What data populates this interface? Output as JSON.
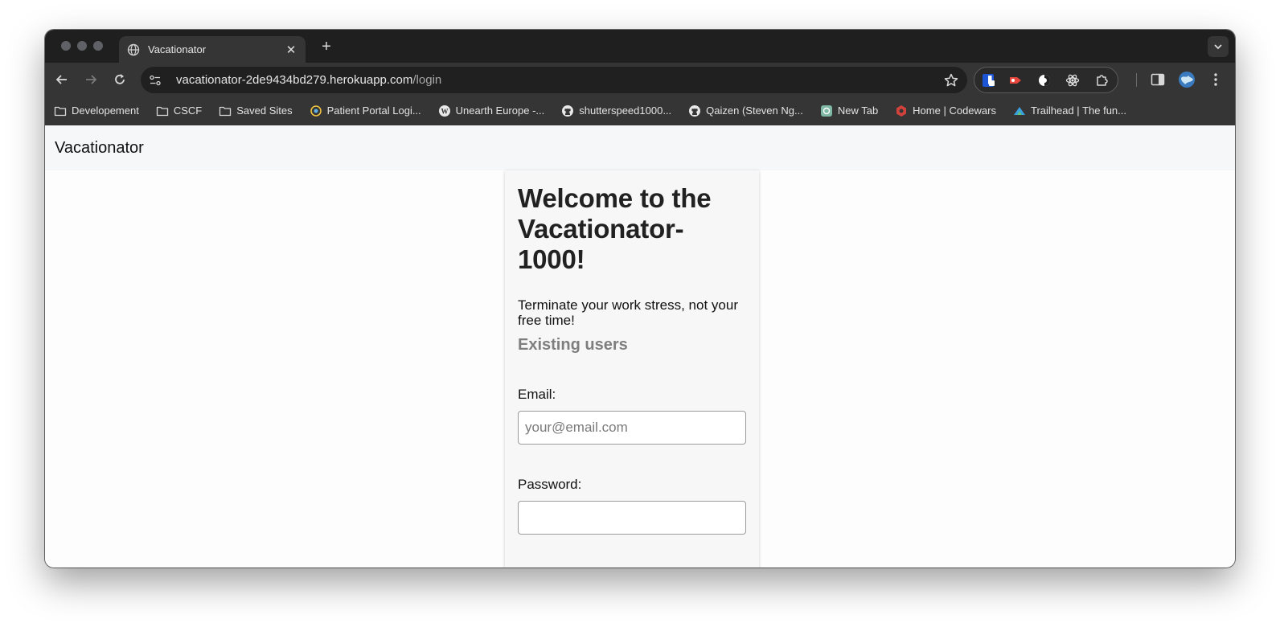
{
  "browser": {
    "tab_title": "Vacationator",
    "url_host": "vacationator-2de9434bd279.herokuapp.com",
    "url_path": "/login",
    "bookmarks": [
      {
        "label": "Developement",
        "icon": "folder-icon"
      },
      {
        "label": "CSCF",
        "icon": "folder-icon"
      },
      {
        "label": "Saved Sites",
        "icon": "folder-icon"
      },
      {
        "label": "Patient Portal Logi...",
        "icon": "portal-icon"
      },
      {
        "label": "Unearth Europe -...",
        "icon": "wordpress-icon"
      },
      {
        "label": "shutterspeed1000...",
        "icon": "github-icon"
      },
      {
        "label": "Qaizen (Steven Ng...",
        "icon": "github-icon"
      },
      {
        "label": "New Tab",
        "icon": "openai-icon"
      },
      {
        "label": "Home | Codewars",
        "icon": "codewars-icon"
      },
      {
        "label": "Trailhead | The fun...",
        "icon": "trailhead-icon"
      }
    ]
  },
  "app": {
    "brand": "Vacationator",
    "heading": "Welcome to the Vacationator-1000!",
    "tagline": "Terminate your work stress, not your free time!",
    "section_title": "Existing users",
    "email_label": "Email:",
    "email_placeholder": "your@email.com",
    "password_label": "Password:",
    "password_value": ""
  },
  "colors": {
    "tabstrip": "#1f1f1f",
    "toolbar": "#353535",
    "omnibox": "#202020",
    "navbar": "#f6f7f8",
    "card": "#f7f7f7",
    "section_title": "#7e7e7e"
  }
}
